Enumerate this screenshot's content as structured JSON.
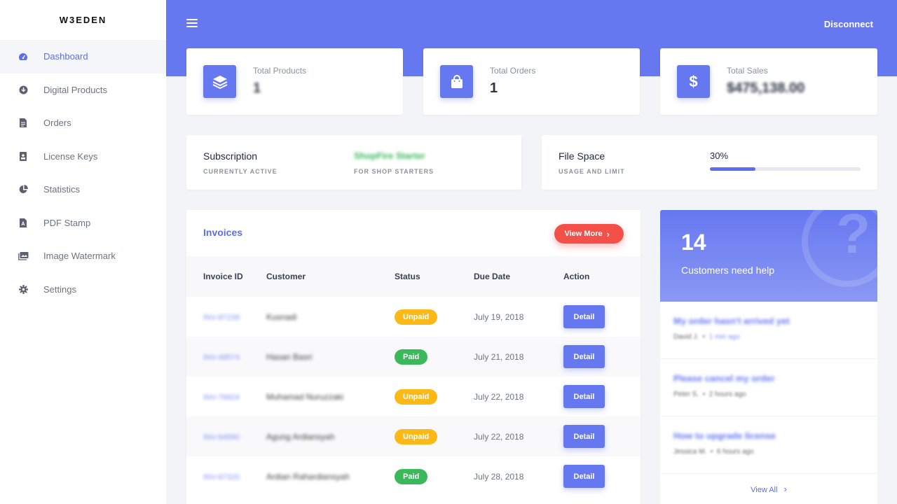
{
  "brand": "W3EDEN",
  "sidebar": {
    "items": [
      {
        "label": "Dashboard",
        "icon": "dashboard-gauge-icon",
        "active": true
      },
      {
        "label": "Digital Products",
        "icon": "download-circle-icon",
        "active": false
      },
      {
        "label": "Orders",
        "icon": "document-icon",
        "active": false
      },
      {
        "label": "License Keys",
        "icon": "id-card-icon",
        "active": false
      },
      {
        "label": "Statistics",
        "icon": "pie-chart-icon",
        "active": false
      },
      {
        "label": "PDF Stamp",
        "icon": "pdf-file-icon",
        "active": false
      },
      {
        "label": "Image Watermark",
        "icon": "images-icon",
        "active": false
      },
      {
        "label": "Settings",
        "icon": "gear-icon",
        "active": false
      }
    ]
  },
  "header": {
    "menu_icon": "hamburger-icon",
    "disconnect_label": "Disconnect"
  },
  "stats": [
    {
      "label": "Total Products",
      "value": "1",
      "icon": "layers-icon"
    },
    {
      "label": "Total Orders",
      "value": "1",
      "icon": "shopping-bag-icon"
    },
    {
      "label": "Total Sales",
      "value": "$475,138.00",
      "icon": "dollar-icon"
    }
  ],
  "subscription": {
    "title": "Subscription",
    "subtitle": "CURRENTLY ACTIVE",
    "plan_name": "ShopFire Starter",
    "plan_desc": "FOR SHOP STARTERS",
    "plan_color": "#3ab85a"
  },
  "file_space": {
    "title": "File Space",
    "subtitle": "USAGE AND LIMIT",
    "percent_label": "30%",
    "percent": 30
  },
  "invoices": {
    "title": "Invoices",
    "view_more_label": "View More",
    "columns": [
      "Invoice ID",
      "Customer",
      "Status",
      "Due Date",
      "Action"
    ],
    "rows": [
      {
        "id": "INV-87239",
        "customer": "Kusnadi",
        "status": "Unpaid",
        "due": "July 19, 2018",
        "action": "Detail"
      },
      {
        "id": "INV-48574",
        "customer": "Hasan Basri",
        "status": "Paid",
        "due": "July 21, 2018",
        "action": "Detail"
      },
      {
        "id": "INV-76824",
        "customer": "Muhamad Nuruzzaki",
        "status": "Unpaid",
        "due": "July 22, 2018",
        "action": "Detail"
      },
      {
        "id": "INV-84990",
        "customer": "Agung Ardiansyah",
        "status": "Unpaid",
        "due": "July 22, 2018",
        "action": "Detail"
      },
      {
        "id": "INV-87320",
        "customer": "Ardian Rahardiansyah",
        "status": "Paid",
        "due": "July 28, 2018",
        "action": "Detail"
      }
    ]
  },
  "help": {
    "count": "14",
    "label": "Customers need help",
    "items": [
      {
        "question": "My order hasn't arrived yet",
        "author": "David J.",
        "time": "1 min ago"
      },
      {
        "question": "Please cancel my order",
        "author": "Peter S.",
        "time": "2 hours ago"
      },
      {
        "question": "How to upgrade license",
        "author": "Jessica M.",
        "time": "6 hours ago"
      }
    ],
    "view_all_label": "View All"
  },
  "colors": {
    "accent": "#6678f0",
    "danger": "#f4504a",
    "warning": "#fbb917",
    "success": "#3ab85a"
  }
}
